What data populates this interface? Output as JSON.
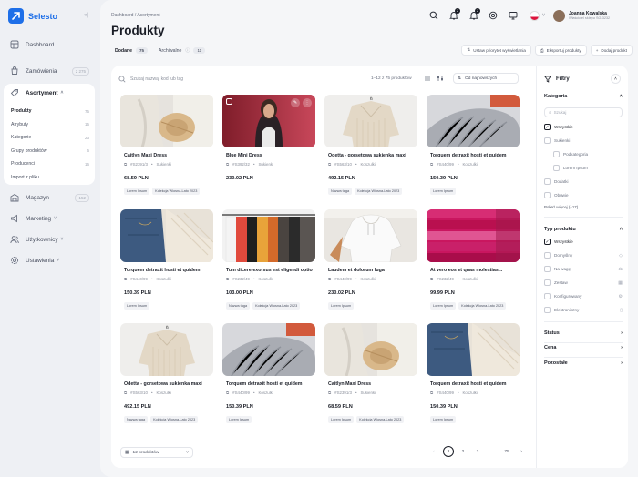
{
  "app": {
    "name": "Selesto"
  },
  "sidebar": {
    "items": [
      {
        "label": "Dashboard",
        "icon": "dashboard-icon"
      },
      {
        "label": "Zamówienia",
        "badge": "2 275",
        "icon": "orders-icon"
      },
      {
        "label": "Asortyment",
        "icon": "assortment-icon"
      },
      {
        "label": "Magazyn",
        "badge": "152",
        "icon": "warehouse-icon"
      },
      {
        "label": "Marketing",
        "icon": "marketing-icon"
      },
      {
        "label": "Użytkownicy",
        "icon": "users-icon"
      },
      {
        "label": "Ustawienia",
        "icon": "settings-icon"
      }
    ],
    "subitems": [
      {
        "label": "Produkty",
        "count": "75"
      },
      {
        "label": "Atrybuty",
        "count": "15"
      },
      {
        "label": "Kategorie",
        "count": "23"
      },
      {
        "label": "Grupy produktów",
        "count": "6"
      },
      {
        "label": "Producenci",
        "count": "16"
      },
      {
        "label": "Import z pliku",
        "count": ""
      }
    ]
  },
  "header": {
    "breadcrumb": "Dashboard / Asortyment",
    "title": "Produkty",
    "notifications": [
      "2",
      "2"
    ],
    "user": {
      "name": "Joanna Kowalska",
      "role": "Właściciel sklepu SG-3232"
    }
  },
  "tabs": [
    {
      "label": "Dodane",
      "count": "75"
    },
    {
      "label": "Archiwalne",
      "count": "11"
    }
  ],
  "actions": [
    "Ustaw priorytet wyświetlania",
    "Eksportuj produkty",
    "Dodaj produkt"
  ],
  "toolbar": {
    "search_placeholder": "Szukaj nazwą, kod lub tag",
    "results": "1–12 z 75 produktów",
    "sort": "Od najnowszych"
  },
  "products": [
    {
      "title": "Caitlyn Maxi Dress",
      "sku": "#S2391/3",
      "cat": "Sukienki",
      "price": "68.59 PLN",
      "tags": [
        "Lorem Ipsum",
        "Kolekcja Wiosna-Lato 2023"
      ],
      "img": "hat"
    },
    {
      "title": "Blue Mini Dress",
      "sku": "#S392/32",
      "cat": "Sukienki",
      "price": "230.02 PLN",
      "tags": [],
      "img": "woman"
    },
    {
      "title": "Odetta - gorsetowa sukienka maxi",
      "sku": "#S563/10",
      "cat": "Koszulki",
      "price": "492.15 PLN",
      "tags": [
        "Nazwa taga",
        "Kolekcja Wiosna-Lato 2023"
      ],
      "img": "knit"
    },
    {
      "title": "Torquem detraxit hosti et quidem",
      "sku": "#S440/99",
      "cat": "Koszulki",
      "price": "150.39 PLN",
      "tags": [
        "Lorem Ipsum"
      ],
      "img": "sweater"
    },
    {
      "title": "Torquem detraxit hosti et quidem",
      "sku": "#S440/99",
      "cat": "Koszulki",
      "price": "150.39 PLN",
      "tags": [
        "Lorem Ipsum"
      ],
      "img": "jeans"
    },
    {
      "title": "Tum dicere exorsus est eligendi optio",
      "sku": "#K232/49",
      "cat": "Koszulki",
      "price": "103.00 PLN",
      "tags": [
        "Nazwa taga",
        "Kolekcja Wiosna-Lato 2023"
      ],
      "img": "rack"
    },
    {
      "title": "Laudem et dolorum fuga",
      "sku": "#S440/99",
      "cat": "Koszulki",
      "price": "230.02 PLN",
      "tags": [
        "Lorem Ipsum"
      ],
      "img": "hoodie"
    },
    {
      "title": "At vero eos et quas molestias...",
      "sku": "#K232/49",
      "cat": "Koszulki",
      "price": "99.99 PLN",
      "tags": [
        "Lorem Ipsum",
        "Kolekcja Wiosna-Lato 2023"
      ],
      "img": "pink"
    },
    {
      "title": "Odetta - gorsetowa sukienka maxi",
      "sku": "#S563/10",
      "cat": "Koszulki",
      "price": "492.15 PLN",
      "tags": [
        "Nazwa taga",
        "Kolekcja Wiosna-Lato 2023"
      ],
      "img": "knit"
    },
    {
      "title": "Torquem detraxit hosti et quidem",
      "sku": "#S440/99",
      "cat": "Koszulki",
      "price": "150.39 PLN",
      "tags": [
        "Lorem Ipsum"
      ],
      "img": "sweater"
    },
    {
      "title": "Caitlyn Maxi Dress",
      "sku": "#S2391/3",
      "cat": "Sukienki",
      "price": "68.59 PLN",
      "tags": [
        "Lorem Ipsum",
        "Kolekcja Wiosna-Lato 2023"
      ],
      "img": "hat"
    },
    {
      "title": "Torquem detraxit hosti et quidem",
      "sku": "#S440/99",
      "cat": "Koszulki",
      "price": "150.39 PLN",
      "tags": [
        "Lorem Ipsum"
      ],
      "img": "jeans"
    }
  ],
  "pagination": {
    "per_page": "12 produktów",
    "pages": [
      "1",
      "2",
      "3",
      "...",
      "75"
    ]
  },
  "filters": {
    "title": "Filtry",
    "category": {
      "title": "Kategoria",
      "search_placeholder": "Szukaj",
      "options": [
        "Wszystkie",
        "Sukienki",
        "Podkategoria",
        "Lorem Ipsum",
        "Dodatki",
        "Obuwie"
      ],
      "more": "Pokaż więcej (+17)"
    },
    "type": {
      "title": "Typ produktu",
      "options": [
        "Wszystkie",
        "Domyślny",
        "Na wagę",
        "Zestaw",
        "Konfigurowany",
        "Elektroniczny"
      ]
    },
    "collapsed": [
      "Status",
      "Cena",
      "Pozostałe"
    ]
  },
  "colors": {
    "accent": "#1e6fe8",
    "text": "#1a1d26",
    "muted": "#8a8f9b"
  }
}
